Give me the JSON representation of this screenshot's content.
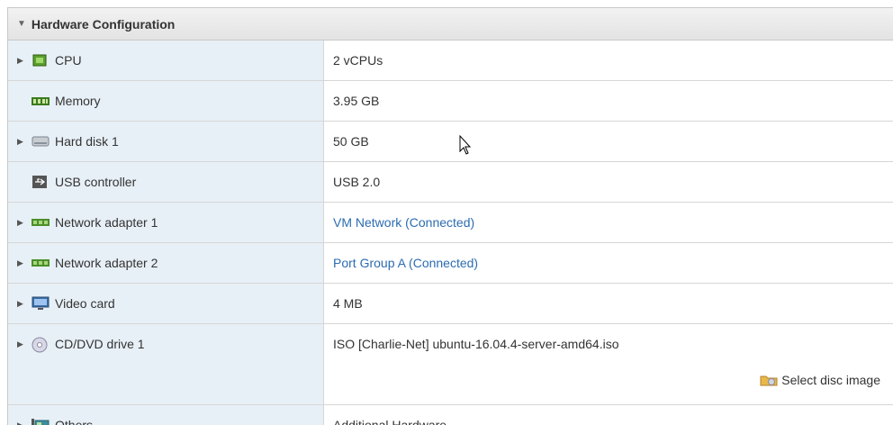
{
  "header": {
    "title": "Hardware Configuration"
  },
  "rows": [
    {
      "label": "CPU",
      "value": "2 vCPUs",
      "icon": "cpu-icon",
      "expandable": true
    },
    {
      "label": "Memory",
      "value": "3.95 GB",
      "icon": "memory-icon",
      "expandable": false
    },
    {
      "label": "Hard disk 1",
      "value": "50 GB",
      "icon": "hard-disk-icon",
      "expandable": true
    },
    {
      "label": "USB controller",
      "value": "USB 2.0",
      "icon": "usb-icon",
      "expandable": false
    },
    {
      "label": "Network adapter 1",
      "value": "VM Network (Connected)",
      "icon": "network-adapter-icon",
      "expandable": true
    },
    {
      "label": "Network adapter 2",
      "value": "Port Group A (Connected)",
      "icon": "network-adapter-icon",
      "expandable": true
    },
    {
      "label": "Video card",
      "value": "4 MB",
      "icon": "video-card-icon",
      "expandable": true
    },
    {
      "label": "CD/DVD drive 1",
      "value": "ISO [Charlie-Net] ubuntu-16.04.4-server-amd64.iso",
      "icon": "cd-dvd-icon",
      "expandable": true,
      "action": "Select disc image"
    },
    {
      "label": "Others",
      "value": "Additional Hardware",
      "icon": "others-icon",
      "expandable": true
    }
  ],
  "colors": {
    "label_bg": "#e8f0f7",
    "link": "#2b6cb0",
    "border": "#d6d6d6"
  }
}
